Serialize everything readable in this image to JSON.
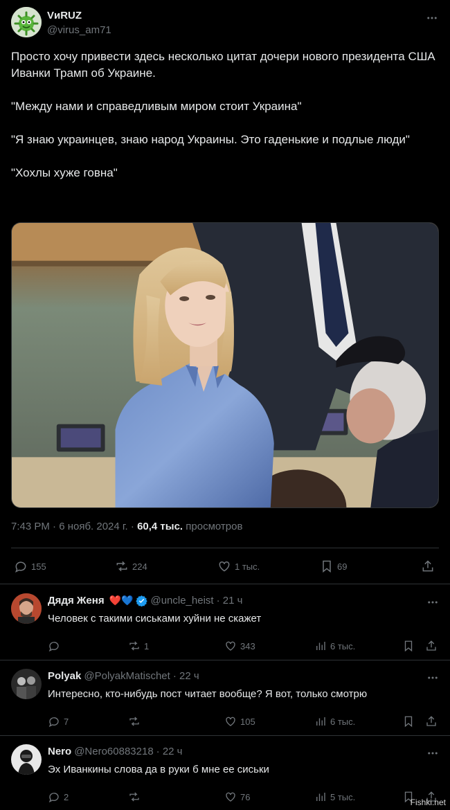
{
  "post": {
    "display_name": "VиRUZ",
    "handle": "@virus_am71",
    "paragraphs": [
      "Просто хочу привести здесь несколько цитат дочери нового президента США Иванки Трамп об Украине.",
      "\"Между нами и справедливым миром стоит Украина\"",
      "\"Я знаю украинцев, знаю народ Украины. Это гаденькие и подлые люди\"",
      "\"Хохлы хуже говна\""
    ],
    "timestamp": "7:43 PM · 6 нояб. 2024 г. ·",
    "views_count": "60,4 тыс.",
    "views_label": "просмотров",
    "stats": {
      "replies": "155",
      "reposts": "224",
      "likes": "1 тыс.",
      "bookmarks": "69"
    }
  },
  "replies": [
    {
      "display_name": "Дядя Женя",
      "emojis": "❤️💙",
      "verified": true,
      "handle": "@uncle_heist",
      "time": "· 21 ч",
      "text": "Человек с такими сиськами хуйни не скажет",
      "stats": {
        "replies": "",
        "reposts": "1",
        "likes": "343",
        "views": "6 тыс."
      }
    },
    {
      "display_name": "Polyak",
      "emojis": "",
      "verified": false,
      "handle": "@PolyakMatischet",
      "time": "· 22 ч",
      "text": "Интересно, кто-нибудь пост читает вообще? Я вот, только смотрю",
      "stats": {
        "replies": "7",
        "reposts": "",
        "likes": "105",
        "views": "6 тыс."
      }
    },
    {
      "display_name": "Nero",
      "emojis": "",
      "verified": false,
      "handle": "@Nero60883218",
      "time": "· 22 ч",
      "text": "Эх Иванкины слова да в руки б мне ее сиськи",
      "stats": {
        "replies": "2",
        "reposts": "",
        "likes": "76",
        "views": "5 тыс."
      }
    }
  ],
  "watermark": "Fishki.net",
  "colors": {
    "background": "#000000",
    "text": "#e7e9ea",
    "muted": "#71767b",
    "divider": "#2f3336",
    "verified": "#1d9bf0"
  }
}
